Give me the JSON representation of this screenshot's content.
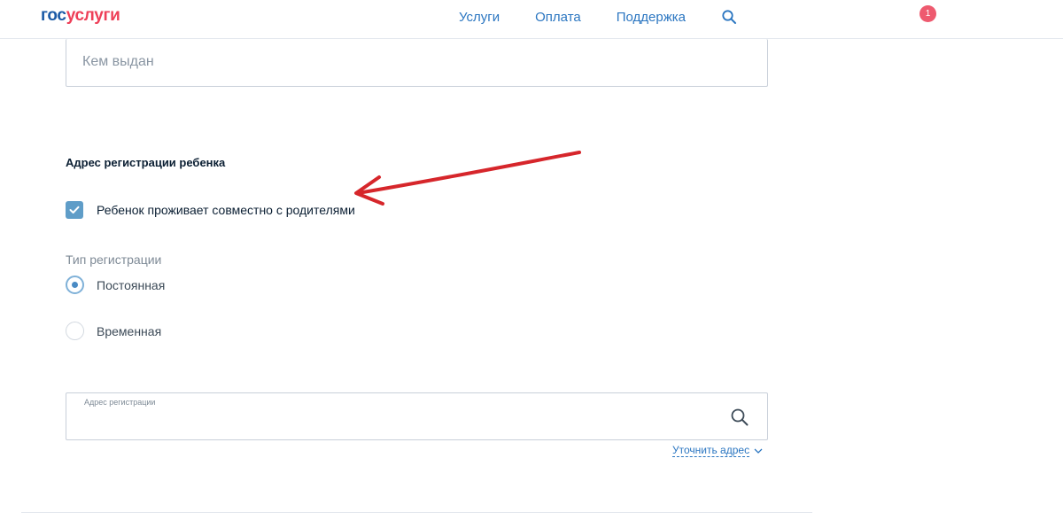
{
  "header": {
    "logo_part1": "гос",
    "logo_part2": "услуги",
    "nav": [
      "Услуги",
      "Оплата",
      "Поддержка"
    ],
    "notification_count": "1"
  },
  "form": {
    "issued_by": {
      "placeholder": "Кем выдан",
      "value": ""
    },
    "section_title": "Адрес регистрации ребенка",
    "lives_with_parents": {
      "label": "Ребенок проживает совместно с родителями",
      "checked": true
    },
    "registration_type": {
      "label": "Тип регистрации",
      "options": [
        "Постоянная",
        "Временная"
      ],
      "selected": "Постоянная"
    },
    "address": {
      "label": "Адрес регистрации",
      "value": ""
    },
    "refine_link": "Уточнить адрес"
  },
  "colors": {
    "brand_blue": "#1b5aa6",
    "brand_red": "#ee3f58",
    "link": "#2b76c1",
    "checkbox": "#5f9dc8",
    "annotation_arrow": "#d6262b"
  }
}
